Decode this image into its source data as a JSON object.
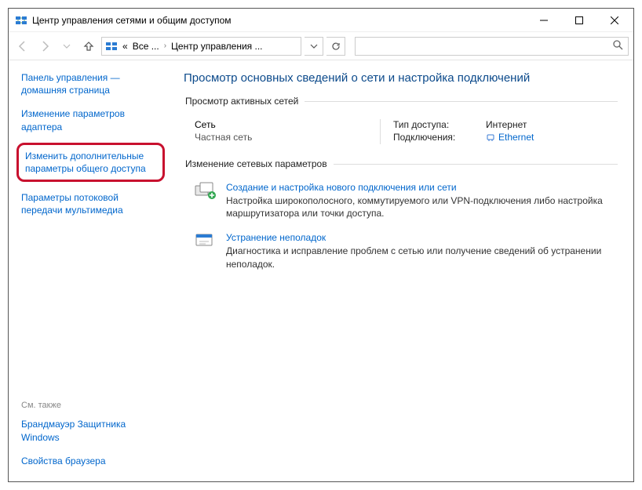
{
  "window": {
    "title": "Центр управления сетями и общим доступом"
  },
  "breadcrumb": {
    "prefix": "«",
    "item1": "Все ...",
    "item2": "Центр управления ..."
  },
  "search": {
    "placeholder": ""
  },
  "sidebar": {
    "items": [
      "Панель управления — домашняя страница",
      "Изменение параметров адаптера",
      "Изменить дополнительные параметры общего доступа",
      "Параметры потоковой передачи мультимедиа"
    ],
    "see_also_heading": "См. также",
    "see_also": [
      "Брандмауэр Защитника Windows",
      "Свойства браузера"
    ]
  },
  "main": {
    "title": "Просмотр основных сведений о сети и настройка подключений",
    "active_networks_legend": "Просмотр активных сетей",
    "network": {
      "name": "Сеть",
      "type": "Частная сеть",
      "access_label": "Тип доступа:",
      "access_value": "Интернет",
      "conn_label": "Подключения:",
      "conn_value": "Ethernet"
    },
    "change_legend": "Изменение сетевых параметров",
    "task1": {
      "title": "Создание и настройка нового подключения или сети",
      "desc": "Настройка широкополосного, коммутируемого или VPN-подключения либо настройка маршрутизатора или точки доступа."
    },
    "task2": {
      "title": "Устранение неполадок",
      "desc": "Диагностика и исправление проблем с сетью или получение сведений об устранении неполадок."
    }
  }
}
